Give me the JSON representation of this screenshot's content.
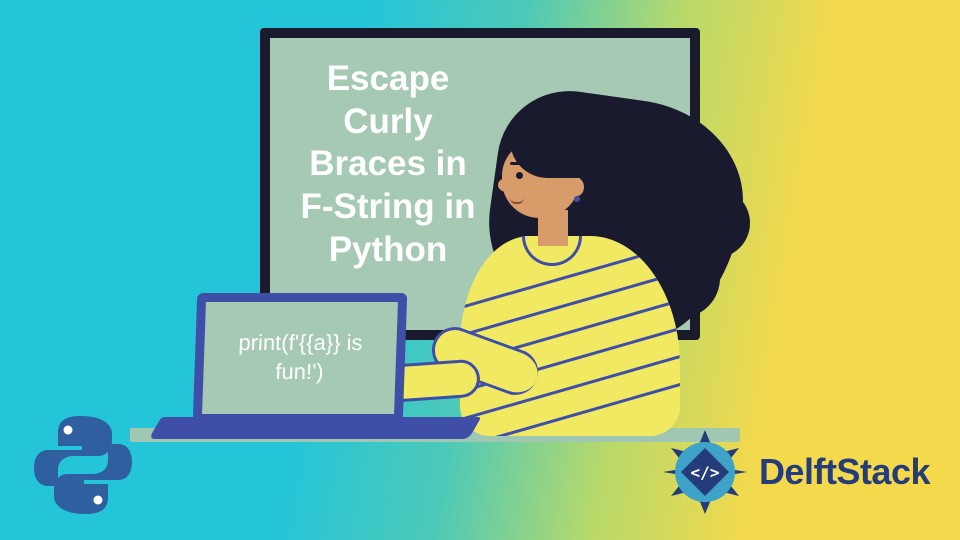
{
  "board": {
    "title": "Escape Curly Braces in F-String in Python"
  },
  "laptop": {
    "code": "print(f'{{a}} is fun!')"
  },
  "branding": {
    "delft_name": "DelftStack",
    "python_icon_name": "python-logo",
    "delft_badge_name": "delftstack-emblem"
  },
  "colors": {
    "board_frame": "#1a1a2e",
    "board_bg": "#a5c9b2",
    "laptop_frame": "#3f4fa8",
    "shirt": "#f2e963",
    "skin": "#d89b6a",
    "brand_blue": "#243c7a"
  }
}
